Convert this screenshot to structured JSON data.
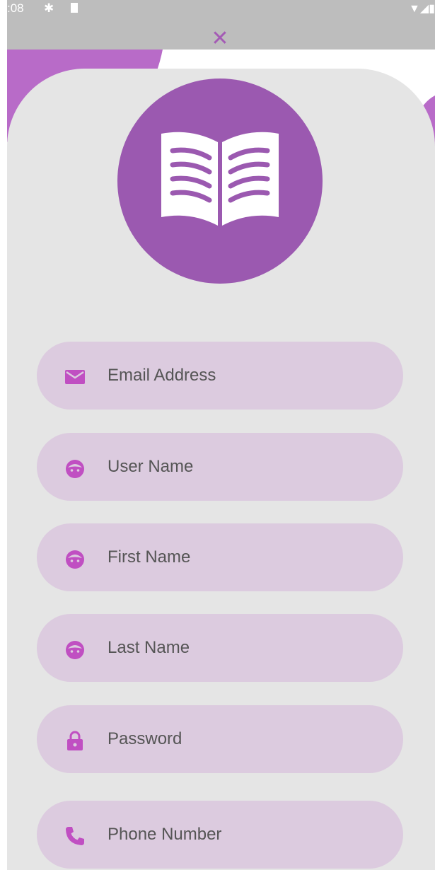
{
  "status_bar": {
    "time": ":08",
    "icons": [
      "gear-icon",
      "sd-card-icon",
      "wifi-icon",
      "signal-icon",
      "battery-icon"
    ]
  },
  "close_glyph": "✕",
  "colors": {
    "accent": "#9b59b0",
    "field_bg": "#dccbdf",
    "card_bg": "#e5e5e5",
    "icon_color": "#c04fc2"
  },
  "logo_icon": "open-book-icon",
  "form": {
    "fields": [
      {
        "placeholder": "Email Address",
        "icon": "email-icon"
      },
      {
        "placeholder": "User Name",
        "icon": "face-icon"
      },
      {
        "placeholder": "First Name",
        "icon": "face-icon"
      },
      {
        "placeholder": "Last Name",
        "icon": "face-icon"
      },
      {
        "placeholder": "Password",
        "icon": "lock-icon"
      },
      {
        "placeholder": "Phone Number",
        "icon": "phone-icon"
      }
    ]
  }
}
